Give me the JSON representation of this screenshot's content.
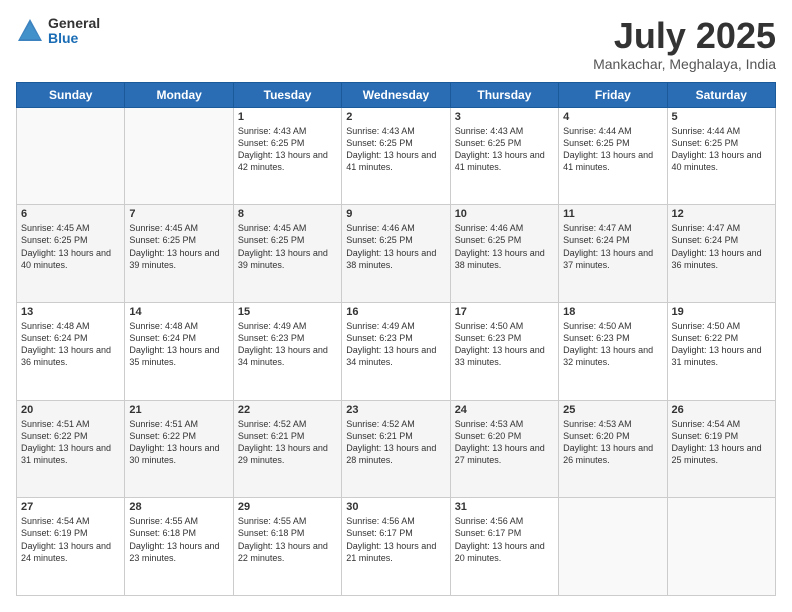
{
  "logo": {
    "general": "General",
    "blue": "Blue"
  },
  "title": "July 2025",
  "location": "Mankachar, Meghalaya, India",
  "weekdays": [
    "Sunday",
    "Monday",
    "Tuesday",
    "Wednesday",
    "Thursday",
    "Friday",
    "Saturday"
  ],
  "weeks": [
    [
      {
        "day": "",
        "sunrise": "",
        "sunset": "",
        "daylight": ""
      },
      {
        "day": "",
        "sunrise": "",
        "sunset": "",
        "daylight": ""
      },
      {
        "day": "1",
        "sunrise": "Sunrise: 4:43 AM",
        "sunset": "Sunset: 6:25 PM",
        "daylight": "Daylight: 13 hours and 42 minutes."
      },
      {
        "day": "2",
        "sunrise": "Sunrise: 4:43 AM",
        "sunset": "Sunset: 6:25 PM",
        "daylight": "Daylight: 13 hours and 41 minutes."
      },
      {
        "day": "3",
        "sunrise": "Sunrise: 4:43 AM",
        "sunset": "Sunset: 6:25 PM",
        "daylight": "Daylight: 13 hours and 41 minutes."
      },
      {
        "day": "4",
        "sunrise": "Sunrise: 4:44 AM",
        "sunset": "Sunset: 6:25 PM",
        "daylight": "Daylight: 13 hours and 41 minutes."
      },
      {
        "day": "5",
        "sunrise": "Sunrise: 4:44 AM",
        "sunset": "Sunset: 6:25 PM",
        "daylight": "Daylight: 13 hours and 40 minutes."
      }
    ],
    [
      {
        "day": "6",
        "sunrise": "Sunrise: 4:45 AM",
        "sunset": "Sunset: 6:25 PM",
        "daylight": "Daylight: 13 hours and 40 minutes."
      },
      {
        "day": "7",
        "sunrise": "Sunrise: 4:45 AM",
        "sunset": "Sunset: 6:25 PM",
        "daylight": "Daylight: 13 hours and 39 minutes."
      },
      {
        "day": "8",
        "sunrise": "Sunrise: 4:45 AM",
        "sunset": "Sunset: 6:25 PM",
        "daylight": "Daylight: 13 hours and 39 minutes."
      },
      {
        "day": "9",
        "sunrise": "Sunrise: 4:46 AM",
        "sunset": "Sunset: 6:25 PM",
        "daylight": "Daylight: 13 hours and 38 minutes."
      },
      {
        "day": "10",
        "sunrise": "Sunrise: 4:46 AM",
        "sunset": "Sunset: 6:25 PM",
        "daylight": "Daylight: 13 hours and 38 minutes."
      },
      {
        "day": "11",
        "sunrise": "Sunrise: 4:47 AM",
        "sunset": "Sunset: 6:24 PM",
        "daylight": "Daylight: 13 hours and 37 minutes."
      },
      {
        "day": "12",
        "sunrise": "Sunrise: 4:47 AM",
        "sunset": "Sunset: 6:24 PM",
        "daylight": "Daylight: 13 hours and 36 minutes."
      }
    ],
    [
      {
        "day": "13",
        "sunrise": "Sunrise: 4:48 AM",
        "sunset": "Sunset: 6:24 PM",
        "daylight": "Daylight: 13 hours and 36 minutes."
      },
      {
        "day": "14",
        "sunrise": "Sunrise: 4:48 AM",
        "sunset": "Sunset: 6:24 PM",
        "daylight": "Daylight: 13 hours and 35 minutes."
      },
      {
        "day": "15",
        "sunrise": "Sunrise: 4:49 AM",
        "sunset": "Sunset: 6:23 PM",
        "daylight": "Daylight: 13 hours and 34 minutes."
      },
      {
        "day": "16",
        "sunrise": "Sunrise: 4:49 AM",
        "sunset": "Sunset: 6:23 PM",
        "daylight": "Daylight: 13 hours and 34 minutes."
      },
      {
        "day": "17",
        "sunrise": "Sunrise: 4:50 AM",
        "sunset": "Sunset: 6:23 PM",
        "daylight": "Daylight: 13 hours and 33 minutes."
      },
      {
        "day": "18",
        "sunrise": "Sunrise: 4:50 AM",
        "sunset": "Sunset: 6:23 PM",
        "daylight": "Daylight: 13 hours and 32 minutes."
      },
      {
        "day": "19",
        "sunrise": "Sunrise: 4:50 AM",
        "sunset": "Sunset: 6:22 PM",
        "daylight": "Daylight: 13 hours and 31 minutes."
      }
    ],
    [
      {
        "day": "20",
        "sunrise": "Sunrise: 4:51 AM",
        "sunset": "Sunset: 6:22 PM",
        "daylight": "Daylight: 13 hours and 31 minutes."
      },
      {
        "day": "21",
        "sunrise": "Sunrise: 4:51 AM",
        "sunset": "Sunset: 6:22 PM",
        "daylight": "Daylight: 13 hours and 30 minutes."
      },
      {
        "day": "22",
        "sunrise": "Sunrise: 4:52 AM",
        "sunset": "Sunset: 6:21 PM",
        "daylight": "Daylight: 13 hours and 29 minutes."
      },
      {
        "day": "23",
        "sunrise": "Sunrise: 4:52 AM",
        "sunset": "Sunset: 6:21 PM",
        "daylight": "Daylight: 13 hours and 28 minutes."
      },
      {
        "day": "24",
        "sunrise": "Sunrise: 4:53 AM",
        "sunset": "Sunset: 6:20 PM",
        "daylight": "Daylight: 13 hours and 27 minutes."
      },
      {
        "day": "25",
        "sunrise": "Sunrise: 4:53 AM",
        "sunset": "Sunset: 6:20 PM",
        "daylight": "Daylight: 13 hours and 26 minutes."
      },
      {
        "day": "26",
        "sunrise": "Sunrise: 4:54 AM",
        "sunset": "Sunset: 6:19 PM",
        "daylight": "Daylight: 13 hours and 25 minutes."
      }
    ],
    [
      {
        "day": "27",
        "sunrise": "Sunrise: 4:54 AM",
        "sunset": "Sunset: 6:19 PM",
        "daylight": "Daylight: 13 hours and 24 minutes."
      },
      {
        "day": "28",
        "sunrise": "Sunrise: 4:55 AM",
        "sunset": "Sunset: 6:18 PM",
        "daylight": "Daylight: 13 hours and 23 minutes."
      },
      {
        "day": "29",
        "sunrise": "Sunrise: 4:55 AM",
        "sunset": "Sunset: 6:18 PM",
        "daylight": "Daylight: 13 hours and 22 minutes."
      },
      {
        "day": "30",
        "sunrise": "Sunrise: 4:56 AM",
        "sunset": "Sunset: 6:17 PM",
        "daylight": "Daylight: 13 hours and 21 minutes."
      },
      {
        "day": "31",
        "sunrise": "Sunrise: 4:56 AM",
        "sunset": "Sunset: 6:17 PM",
        "daylight": "Daylight: 13 hours and 20 minutes."
      },
      {
        "day": "",
        "sunrise": "",
        "sunset": "",
        "daylight": ""
      },
      {
        "day": "",
        "sunrise": "",
        "sunset": "",
        "daylight": ""
      }
    ]
  ]
}
